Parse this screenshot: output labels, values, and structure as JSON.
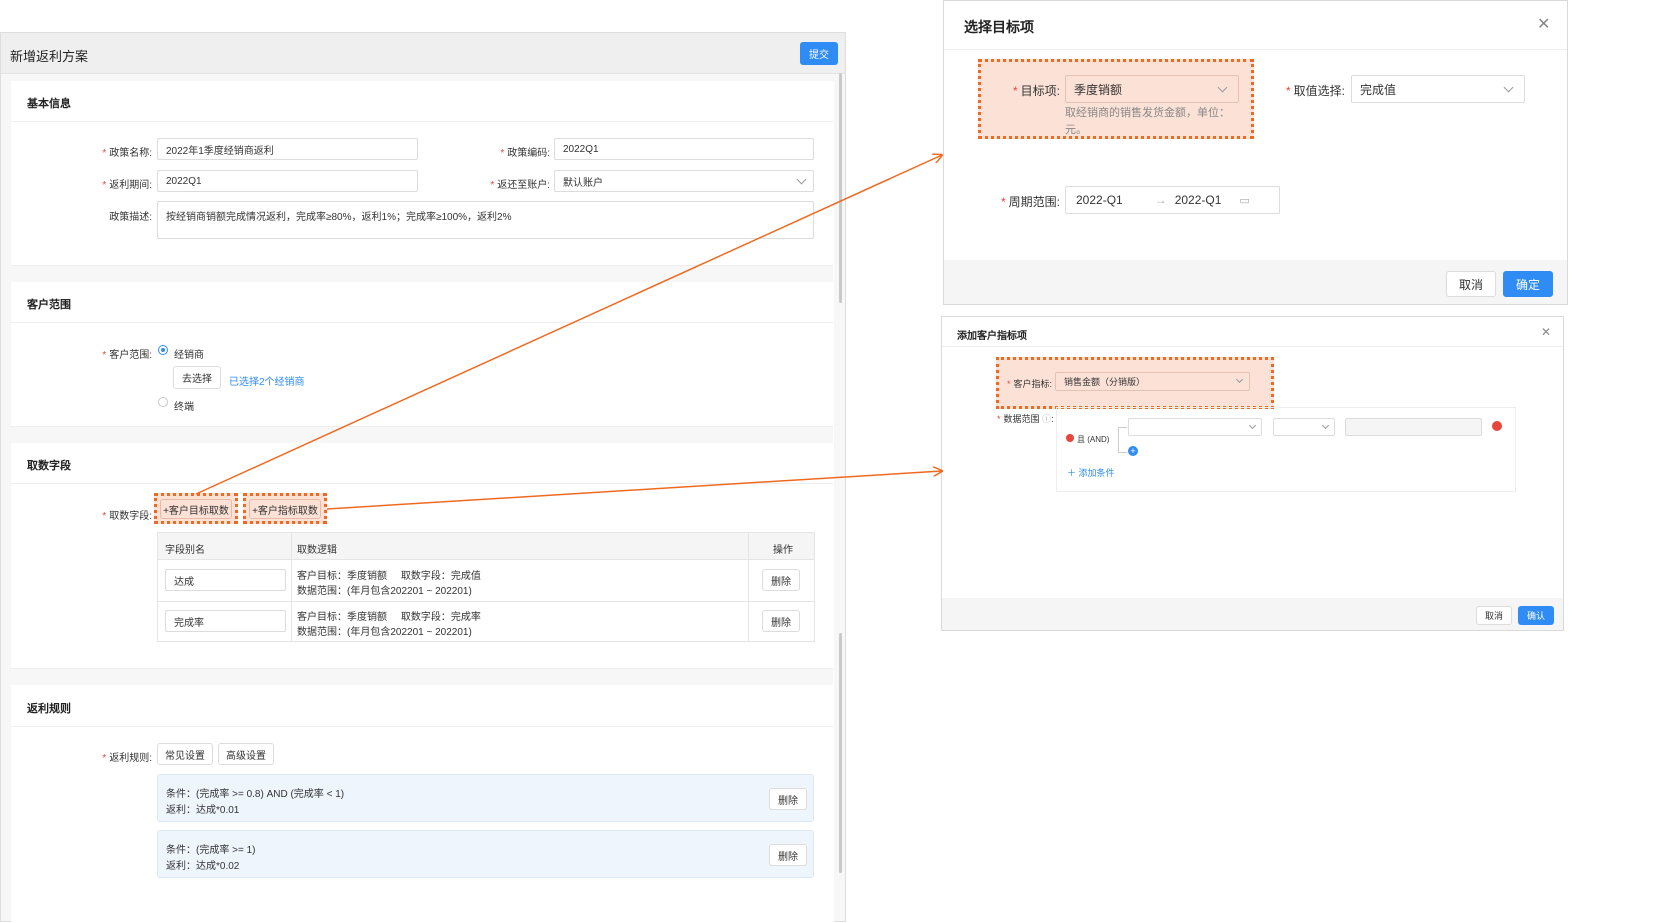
{
  "main": {
    "title": "新增返利方案",
    "submit": "提交",
    "basic": {
      "title": "基本信息",
      "policy_name_label": "政策名称:",
      "policy_name_value": "2022年1季度经销商返利",
      "policy_code_label": "政策编码:",
      "policy_code_value": "2022Q1",
      "period_label": "返利期间:",
      "period_value": "2022Q1",
      "account_label": "返还至账户:",
      "account_value": "默认账户",
      "desc_label": "政策描述:",
      "desc_value": "按经销商销额完成情况返利，完成率≥80%，返利1%；完成率≥100%，返利2%"
    },
    "customer": {
      "title": "客户范围",
      "label": "客户范围:",
      "option_dealer": "经销商",
      "select_btn": "去选择",
      "selected_link": "已选择2个经销商",
      "option_terminal": "终端"
    },
    "fields": {
      "title": "取数字段",
      "label": "取数字段:",
      "btn_target": "+客户目标取数",
      "btn_indicator": "+客户指标取数",
      "col_alias": "字段别名",
      "col_logic": "取数逻辑",
      "col_action": "操作",
      "rows": [
        {
          "alias": "达成",
          "line1": "客户目标：季度销额     取数字段：完成值",
          "line2": "数据范围：(年月包含202201 ~ 202201)",
          "action": "删除"
        },
        {
          "alias": "完成率",
          "line1": "客户目标：季度销额     取数字段：完成率",
          "line2": "数据范围：(年月包含202201 ~ 202201)",
          "action": "删除"
        }
      ]
    },
    "rules": {
      "title": "返利规则",
      "label": "返利规则:",
      "tab_common": "常见设置",
      "tab_advanced": "高级设置",
      "items": [
        {
          "cond": "条件：(完成率 >= 0.8) AND (完成率 < 1)",
          "rebate": "返利：达成*0.01",
          "action": "删除"
        },
        {
          "cond": "条件：(完成率 >= 1)",
          "rebate": "返利：达成*0.02",
          "action": "删除"
        }
      ]
    }
  },
  "modal_target": {
    "title": "选择目标项",
    "target_label": "目标项:",
    "target_value": "季度销额",
    "target_hint": "取经销商的销售发货金额，单位：元。",
    "value_label": "取值选择:",
    "value_value": "完成值",
    "period_label": "周期范围:",
    "period_start": "2022-Q1",
    "period_sep": "→",
    "period_end": "2022-Q1",
    "cancel": "取消",
    "ok": "确定"
  },
  "modal_indicator": {
    "title": "添加客户指标项",
    "indicator_label": "客户指标:",
    "indicator_value": "销售金额（分销版）",
    "range_label": "数据范围",
    "and_label": "且 (AND)",
    "add_condition": "添加条件",
    "cancel": "取消",
    "ok": "确认"
  },
  "colors": {
    "primary": "#2f8cf5",
    "highlight": "#ef6a20",
    "danger": "#e8453c"
  }
}
